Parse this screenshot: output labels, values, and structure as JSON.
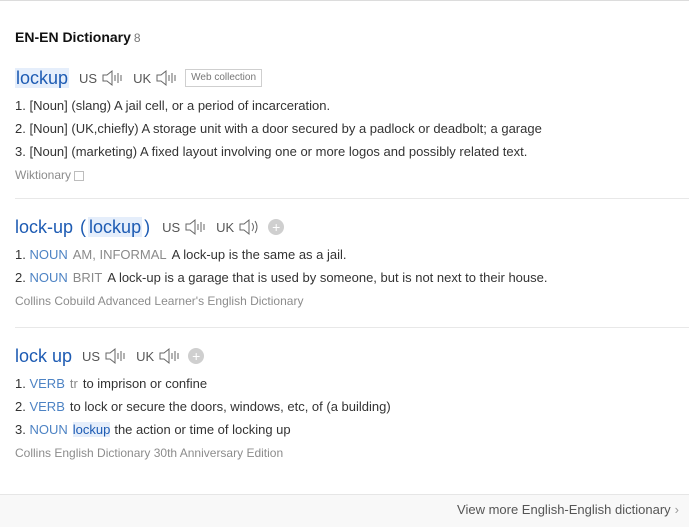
{
  "header": {
    "title": "EN-EN Dictionary",
    "count": "8"
  },
  "entries": [
    {
      "headword": "lockup",
      "us_label": "US",
      "uk_label": "UK",
      "tag": "Web collection",
      "definitions": [
        {
          "num": "1.",
          "text": "[Noun] (slang) A jail cell, or a period of incarceration."
        },
        {
          "num": "2.",
          "text": "[Noun] (UK,chiefly) A storage unit with a door secured by a padlock or deadbolt; a garage"
        },
        {
          "num": "3.",
          "text": "[Noun] (marketing) A fixed layout involving one or more logos and possibly related text."
        }
      ],
      "source": "Wiktionary"
    },
    {
      "headword": "lock-up",
      "paren_open": "(",
      "alt": "lockup",
      "paren_close": ")",
      "us_label": "US",
      "uk_label": "UK",
      "definitions": [
        {
          "num": "1.",
          "pos": "NOUN",
          "gram": "AM, INFORMAL",
          "text": "A lock-up is the same as a jail."
        },
        {
          "num": "2.",
          "pos": "NOUN",
          "gram": "BRIT",
          "text": "A lock-up is a garage that is used by someone, but is not next to their house."
        }
      ],
      "source": "Collins Cobuild Advanced Learner's English Dictionary"
    },
    {
      "headword": "lock up",
      "us_label": "US",
      "uk_label": "UK",
      "definitions": [
        {
          "num": "1.",
          "pos": "VERB",
          "gram": "tr",
          "text": "to imprison or confine"
        },
        {
          "num": "2.",
          "pos": "VERB",
          "text": "to lock or secure the doors, windows, etc, of (a building)"
        },
        {
          "num": "3.",
          "pos": "NOUN",
          "link": "lockup",
          "text": "the action or time of locking up"
        }
      ],
      "source": "Collins English Dictionary 30th Anniversary Edition"
    }
  ],
  "footer": {
    "view_more": "View more English-English dictionary"
  },
  "colors": {
    "accent": "#1d5bb3",
    "pos": "#4d83c4",
    "muted": "#8c8c8c"
  }
}
